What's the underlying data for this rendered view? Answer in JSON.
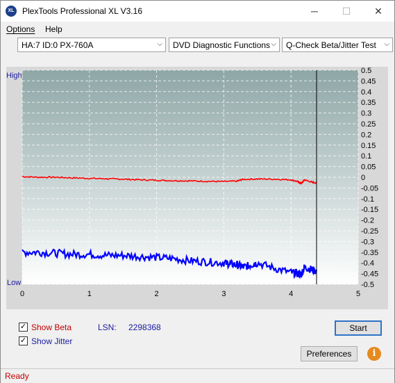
{
  "window": {
    "title": "PlexTools Professional XL V3.16",
    "icon_text": "XL",
    "minimize_glyph": "─",
    "maximize_glyph": "☐",
    "close_glyph": "✕"
  },
  "menu": {
    "options": "Options",
    "help": "Help"
  },
  "toolbar": {
    "drive": "HA:7 ID:0  PX-760A",
    "function": "DVD Diagnostic Functions",
    "test": "Q-Check Beta/Jitter Test",
    "arrow": "⌵"
  },
  "chart_data": {
    "type": "line",
    "left_axis_labels": {
      "top": "High",
      "bottom": "Low"
    },
    "x_ticks": [
      "0",
      "1",
      "2",
      "3",
      "4",
      "5"
    ],
    "xlim": [
      0,
      5
    ],
    "ylim": [
      -0.5,
      0.5
    ],
    "y_ticks": [
      "0.5",
      "0.45",
      "0.4",
      "0.35",
      "0.3",
      "0.25",
      "0.2",
      "0.15",
      "0.1",
      "0.05",
      "0",
      "-0.05",
      "-0.1",
      "-0.15",
      "-0.2",
      "-0.25",
      "-0.3",
      "-0.35",
      "-0.4",
      "-0.45",
      "-0.5"
    ],
    "grid": true,
    "end_marker_x": 4.38,
    "series": [
      {
        "color": "#ff0000",
        "x": [
          0,
          0.25,
          0.5,
          0.75,
          1.0,
          1.25,
          1.5,
          1.75,
          2.0,
          2.25,
          2.5,
          2.75,
          3.0,
          3.2,
          3.28,
          3.5,
          3.75,
          4.0,
          4.1,
          4.15,
          4.2,
          4.3,
          4.38
        ],
        "y": [
          0.003,
          0.0,
          0.0,
          -0.003,
          -0.005,
          -0.007,
          -0.009,
          -0.012,
          -0.014,
          -0.016,
          -0.017,
          -0.019,
          -0.02,
          -0.018,
          -0.01,
          -0.008,
          -0.009,
          -0.012,
          -0.02,
          -0.03,
          -0.012,
          -0.022,
          -0.027
        ]
      },
      {
        "color": "#0000ff",
        "x": [
          0,
          0.25,
          0.5,
          0.75,
          1.0,
          1.25,
          1.5,
          1.75,
          2.0,
          2.25,
          2.5,
          2.75,
          3.0,
          3.1,
          3.2,
          3.3,
          3.4,
          3.5,
          3.75,
          4.0,
          4.1,
          4.15,
          4.2,
          4.3,
          4.38
        ],
        "y": [
          -0.35,
          -0.35,
          -0.355,
          -0.36,
          -0.36,
          -0.365,
          -0.365,
          -0.37,
          -0.375,
          -0.38,
          -0.39,
          -0.395,
          -0.4,
          -0.405,
          -0.41,
          -0.42,
          -0.41,
          -0.4,
          -0.425,
          -0.445,
          -0.45,
          -0.455,
          -0.42,
          -0.43,
          -0.44
        ]
      }
    ]
  },
  "options_panel": {
    "show_beta_label": "Show Beta",
    "show_beta_checked": true,
    "show_jitter_label": "Show Jitter",
    "show_jitter_checked": true,
    "lsn_label": "LSN:",
    "lsn_value": "2298368",
    "start_label": "Start",
    "preferences_label": "Preferences",
    "info_glyph": "i",
    "check_glyph": "✓"
  },
  "status": {
    "text": "Ready"
  },
  "colors": {
    "beta_label": "#c00000",
    "jitter_label": "#1a1aa0",
    "lsn": "#1a1aa0",
    "status": "#c00000"
  }
}
